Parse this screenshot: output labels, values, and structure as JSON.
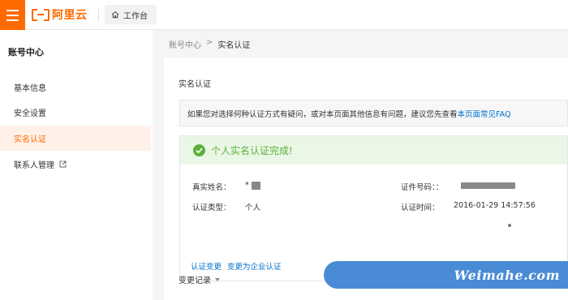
{
  "header": {
    "brand": "阿里云",
    "workbench_label": "工作台"
  },
  "sidebar": {
    "title": "账号中心",
    "items": [
      {
        "label": "基本信息"
      },
      {
        "label": "安全设置"
      },
      {
        "label": "实名认证"
      },
      {
        "label": "联系人管理"
      }
    ]
  },
  "breadcrumb": {
    "root": "账号中心",
    "separator": ">",
    "current": "实名认证"
  },
  "panel": {
    "title": "实名认证",
    "notice": {
      "text": "如果您对选择何种认证方式有疑问，或对本页面其他信息有问题，建议您先查看",
      "link": "本页面常见FAQ"
    },
    "success_text": "个人实名认证完成!",
    "fields": {
      "name_label": "真实姓名：",
      "name_value": "*",
      "type_label": "认证类型：",
      "type_value": "个人",
      "id_label": "证件号码：：",
      "time_label": "认证时间：",
      "time_value": "2016-01-29 14:57:56"
    },
    "links": [
      "认证变更",
      "变更为企业认证"
    ],
    "history_label": "变更记录"
  },
  "watermark": {
    "text": "Weimahe.com",
    "color": "#4a8bd6"
  },
  "colors": {
    "brand": "#ff6a00",
    "link": "#0070cc",
    "success": "#5fb03b",
    "success_bg": "#ebf7e6"
  }
}
